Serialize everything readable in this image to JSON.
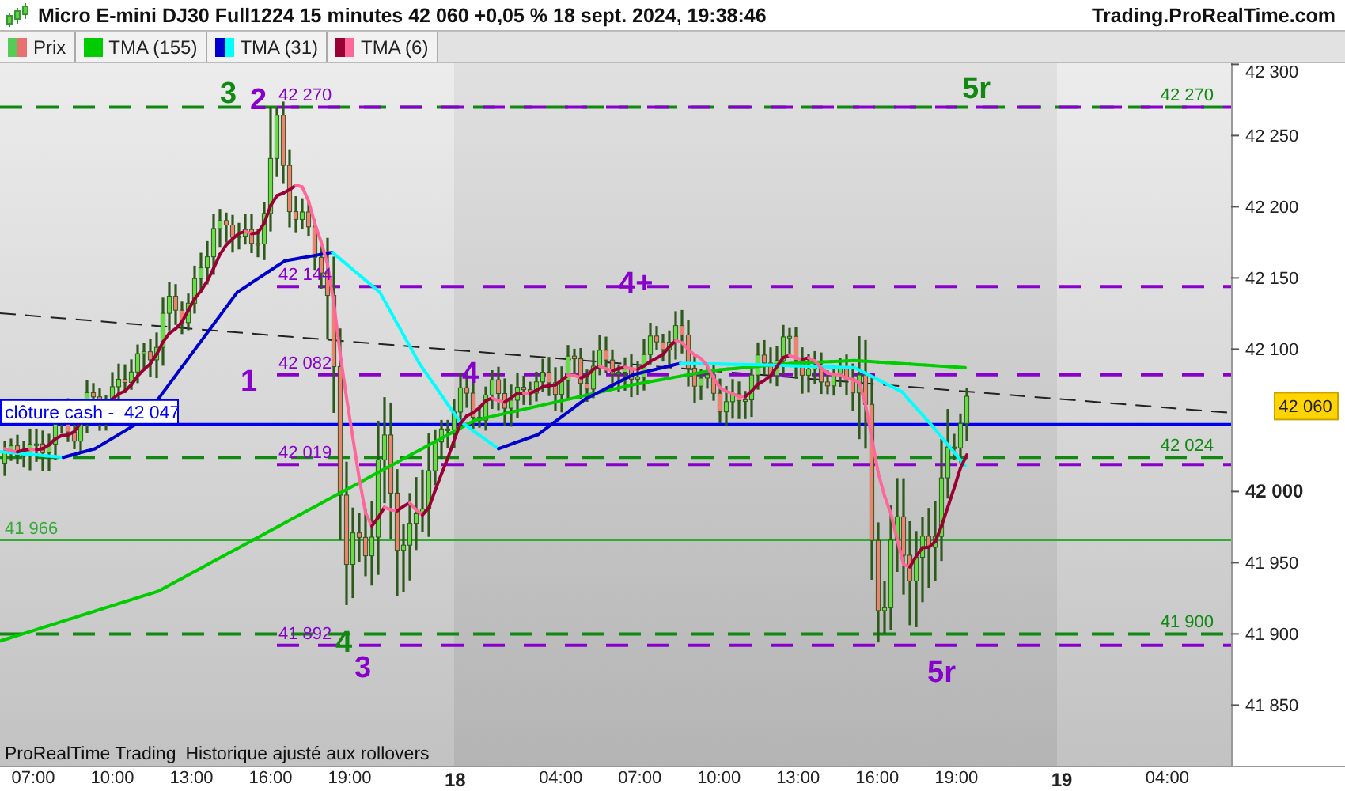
{
  "header": {
    "title": "Micro E-mini DJ30 Full1224 15 minutes 42 060 +0,05 % 18 sept. 2024, 19:38:46",
    "site": "Trading.ProRealTime.com"
  },
  "legend": [
    {
      "label": "Prix",
      "swatches": [
        {
          "color": "#55cc55"
        },
        {
          "color": "#e87070"
        }
      ]
    },
    {
      "label": "TMA (155)",
      "swatches": [
        {
          "color": "#00cc00"
        }
      ]
    },
    {
      "label": "TMA (31)",
      "swatches": [
        {
          "color": "#0000cc"
        },
        {
          "color": "#00ffff"
        }
      ]
    },
    {
      "label": "TMA (6)",
      "swatches": [
        {
          "color": "#990033"
        },
        {
          "color": "#ff6699"
        }
      ]
    }
  ],
  "chart": {
    "levels": [
      {
        "kind": "target",
        "label": "42 270",
        "color": "#118811"
      },
      {
        "kind": "retracement",
        "label": "42 270",
        "color": "#8800cc"
      },
      {
        "kind": "retracement",
        "label": "42 144",
        "color": "#8800cc"
      },
      {
        "kind": "retracement",
        "label": "42 082",
        "color": "#8800cc"
      },
      {
        "kind": "close",
        "label": "clôture cash -",
        "value": "42 047",
        "color": "#0000ee"
      },
      {
        "kind": "target",
        "label": "42 024",
        "color": "#118811"
      },
      {
        "kind": "retracement",
        "label": "42 019",
        "color": "#8800cc"
      },
      {
        "kind": "reference",
        "label": "41 966",
        "color": "#33aa33"
      },
      {
        "kind": "target",
        "label": "41 900",
        "color": "#118811"
      },
      {
        "kind": "retracement",
        "label": "41 892",
        "color": "#8800cc"
      }
    ],
    "wave_labels": [
      {
        "label": "3",
        "color": "#118811"
      },
      {
        "label": "2",
        "color": "#8800cc"
      },
      {
        "label": "1",
        "color": "#8800cc"
      },
      {
        "label": "4",
        "color": "#8800cc"
      },
      {
        "label": "4+",
        "color": "#8800cc"
      },
      {
        "label": "5r",
        "color": "#118811"
      },
      {
        "label": "4",
        "color": "#118811"
      },
      {
        "label": "3",
        "color": "#8800cc"
      },
      {
        "label": "5r",
        "color": "#8800cc"
      }
    ],
    "notes": [
      "ProRealTime Trading",
      "Historique ajusté aux rollovers"
    ],
    "price_axis": [
      {
        "label": "42 300",
        "major": false
      },
      {
        "label": "42 250",
        "major": false
      },
      {
        "label": "42 200",
        "major": false
      },
      {
        "label": "42 150",
        "major": false
      },
      {
        "label": "42 100",
        "major": false
      },
      {
        "label": "42 000",
        "major": true
      },
      {
        "label": "41 950",
        "major": false
      },
      {
        "label": "41 900",
        "major": false
      },
      {
        "label": "41 850",
        "major": false
      }
    ],
    "current_price": "42 060",
    "time_axis": [
      {
        "label": "07:00",
        "kind": "time"
      },
      {
        "label": "10:00",
        "kind": "time"
      },
      {
        "label": "13:00",
        "kind": "time"
      },
      {
        "label": "16:00",
        "kind": "time"
      },
      {
        "label": "19:00",
        "kind": "time"
      },
      {
        "label": "18",
        "kind": "day"
      },
      {
        "label": "04:00",
        "kind": "time"
      },
      {
        "label": "07:00",
        "kind": "time"
      },
      {
        "label": "10:00",
        "kind": "time"
      },
      {
        "label": "13:00",
        "kind": "time"
      },
      {
        "label": "16:00",
        "kind": "time"
      },
      {
        "label": "19:00",
        "kind": "time"
      },
      {
        "label": "19",
        "kind": "day"
      },
      {
        "label": "04:00",
        "kind": "time"
      }
    ]
  }
}
